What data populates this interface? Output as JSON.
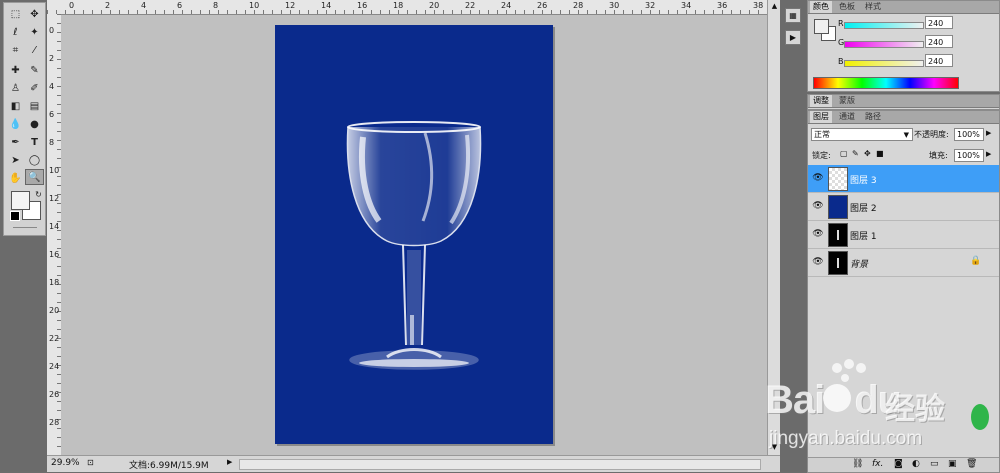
{
  "status": {
    "zoom": "29.9%",
    "doc_info": "文档:6.99M/15.9M"
  },
  "ruler_top": [
    "0",
    "2",
    "4",
    "6",
    "8",
    "10",
    "12",
    "14",
    "16",
    "18",
    "20",
    "22",
    "24",
    "26",
    "28",
    "30",
    "32",
    "34",
    "36",
    "38"
  ],
  "ruler_left": [
    "0",
    "2",
    "4",
    "6",
    "8",
    "10",
    "12",
    "14",
    "16",
    "18",
    "20",
    "22",
    "24",
    "26",
    "28"
  ],
  "color_panel": {
    "tabs": [
      "颜色",
      "色板",
      "样式"
    ],
    "r_label": "R",
    "r_value": "240",
    "g_label": "G",
    "g_value": "240",
    "b_label": "B",
    "b_value": "240",
    "foreground": "#f0f0f0"
  },
  "adjust_panel": {
    "tabs": [
      "调整",
      "蒙版"
    ]
  },
  "layers_panel": {
    "tabs": [
      "图层",
      "通道",
      "路径"
    ],
    "blend_mode": "正常",
    "opacity_label": "不透明度:",
    "opacity_value": "100%",
    "lock_label": "锁定:",
    "fill_label": "填充:",
    "fill_value": "100%",
    "layers": [
      {
        "name": "图层 3",
        "selected": true
      },
      {
        "name": "图层 2",
        "selected": false
      },
      {
        "name": "图层 1",
        "selected": false
      },
      {
        "name": "背景",
        "selected": false
      }
    ],
    "bottom_icons": [
      "fx."
    ]
  },
  "colors": {
    "document_bg": "#0a2a8c",
    "selected_layer": "#3e9ef7"
  },
  "watermark": {
    "brand": "Bai",
    "brand2": "du",
    "cn": "经验",
    "url": "jingyan.baidu.com"
  }
}
